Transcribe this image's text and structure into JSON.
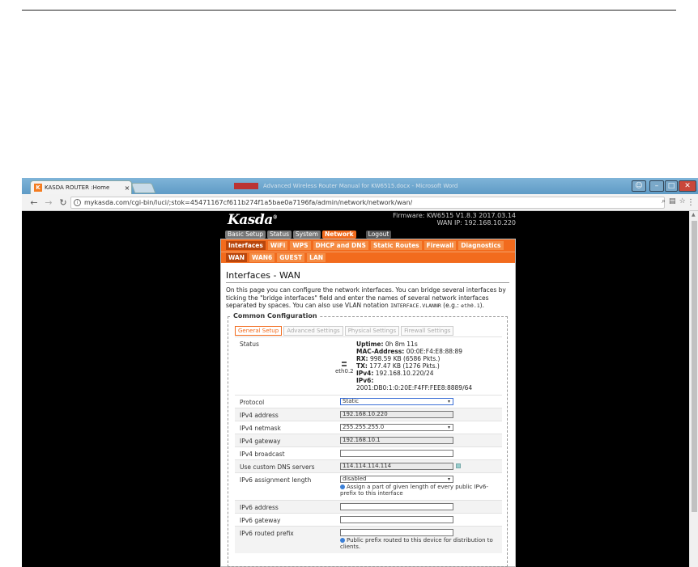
{
  "browser": {
    "tab_title": "KASDA ROUTER :Home",
    "tab_close": "×",
    "other_window_title": "Advanced Wireless Router Manual for KW6515.docx - Microsoft Word",
    "url": "mykasda.com/cgi-bin/luci/;stok=45471167cf611b274f1a5bae0a7196fa/admin/network/network/wan/",
    "icons": [
      "back-icon",
      "forward-icon",
      "reload-icon",
      "info-icon",
      "zoom-icon",
      "translate-icon",
      "star-icon",
      "menu-icon"
    ]
  },
  "router": {
    "logo": "Kasda",
    "firmware": "Firmware: KW6515 V1.8.3 2017.03.14",
    "wan_ip": "WAN IP: 192.168.10.220",
    "menu": [
      "Basic Setup",
      "Status",
      "System",
      "Network",
      "Logout"
    ],
    "submenu": [
      "Interfaces",
      "WiFi",
      "WPS",
      "DHCP and DNS",
      "Static Routes",
      "Firewall",
      "Diagnostics"
    ],
    "interfaces": [
      "WAN",
      "WAN6",
      "GUEST",
      "LAN"
    ]
  },
  "page": {
    "title": "Interfaces - WAN",
    "desc1": "On this page you can configure the network interfaces. You can bridge several interfaces by ticking the \"bridge interfaces\" field and enter the names of several network interfaces separated by spaces. You can also use ",
    "desc_vlan": "VLAN",
    "desc2": " notation ",
    "desc_code": "INTERFACE.VLANNR",
    "desc3": " (",
    "desc_eg": "e.g.",
    "desc4": ": ",
    "desc_code2": "eth0.1",
    "desc5": ").",
    "legend": "Common Configuration",
    "tabs": [
      "General Setup",
      "Advanced Settings",
      "Physical Settings",
      "Firewall Settings"
    ]
  },
  "status": {
    "label": "Status",
    "device": "eth0.2",
    "uptime_k": "Uptime:",
    "uptime_v": " 0h 8m 11s",
    "mac_k": "MAC-Address:",
    "mac_v": " 00:0E:F4:E8:88:89",
    "rx_k": "RX:",
    "rx_v": " 998.59 KB (6586 Pkts.)",
    "tx_k": "TX:",
    "tx_v": " 177.47 KB (1276 Pkts.)",
    "ipv4_k": "IPv4:",
    "ipv4_v": " 192.168.10.220/24",
    "ipv6_k": "IPv6:",
    "ipv6_v": "2001:DB0:1:0:20E:F4FF:FEE8:8889/64"
  },
  "fields": {
    "protocol": {
      "label": "Protocol",
      "value": "Static"
    },
    "ipv4_address": {
      "label": "IPv4 address",
      "value": "192.168.10.220"
    },
    "ipv4_netmask": {
      "label": "IPv4 netmask",
      "value": "255.255.255.0"
    },
    "ipv4_gateway": {
      "label": "IPv4 gateway",
      "value": "192.168.10.1"
    },
    "ipv4_broadcast": {
      "label": "IPv4 broadcast",
      "value": ""
    },
    "dns": {
      "label": "Use custom DNS servers",
      "value": "114.114.114.114"
    },
    "ipv6_len": {
      "label": "IPv6 assignment length",
      "value": "disabled",
      "help": "Assign a part of given length of every public IPv6-prefix to this interface"
    },
    "ipv6_address": {
      "label": "IPv6 address",
      "value": ""
    },
    "ipv6_gateway": {
      "label": "IPv6 gateway",
      "value": ""
    },
    "ipv6_prefix": {
      "label": "IPv6 routed prefix",
      "value": "",
      "help": "Public prefix routed to this device for distribution to clients."
    }
  },
  "colors": {
    "accent": "#f26b1d",
    "background": "#000000"
  }
}
